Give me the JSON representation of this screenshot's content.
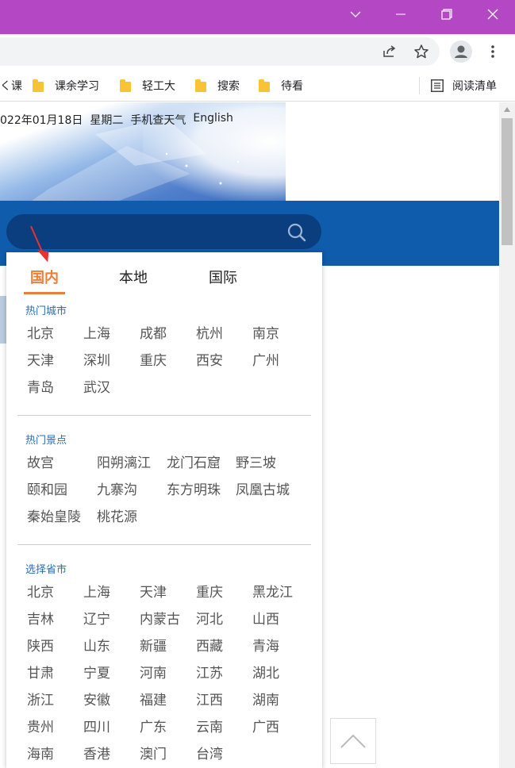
{
  "browser": {
    "bookmarks": [
      {
        "label": "く课"
      },
      {
        "label": "课余学习"
      },
      {
        "label": "轻工大"
      },
      {
        "label": "搜索"
      },
      {
        "label": "待看"
      }
    ],
    "reading_list": "阅读清单"
  },
  "header": {
    "date": "022年01月18日",
    "weekday": "星期二",
    "mobile_weather": "手机查天气",
    "english": "English"
  },
  "dropdown": {
    "tabs": [
      "国内",
      "本地",
      "国际"
    ],
    "active_tab": "国内",
    "hot_cities_title": "热门城市",
    "hot_cities": [
      "北京",
      "上海",
      "成都",
      "杭州",
      "南京",
      "天津",
      "深圳",
      "重庆",
      "西安",
      "广州",
      "青岛",
      "武汉"
    ],
    "hot_spots_title": "热门景点",
    "hot_spots": [
      "故宫",
      "阳朔漓江",
      "龙门石窟",
      "野三坡",
      "颐和园",
      "九寨沟",
      "东方明珠",
      "凤凰古城",
      "秦始皇陵",
      "桃花源"
    ],
    "provinces_title": "选择省市",
    "provinces": [
      "北京",
      "上海",
      "天津",
      "重庆",
      "黑龙江",
      "吉林",
      "辽宁",
      "内蒙古",
      "河北",
      "山西",
      "陕西",
      "山东",
      "新疆",
      "西藏",
      "青海",
      "甘肃",
      "宁夏",
      "河南",
      "江苏",
      "湖北",
      "浙江",
      "安徽",
      "福建",
      "江西",
      "湖南",
      "贵州",
      "四川",
      "广东",
      "云南",
      "广西",
      "海南",
      "香港",
      "澳门",
      "台湾"
    ]
  },
  "colors": {
    "titlebar": "#b447c4",
    "blue_bar": "#0f5cad",
    "search_box": "#0a3e7e",
    "active_tab": "#ef7d3a",
    "section_title": "#2a6cb6"
  }
}
